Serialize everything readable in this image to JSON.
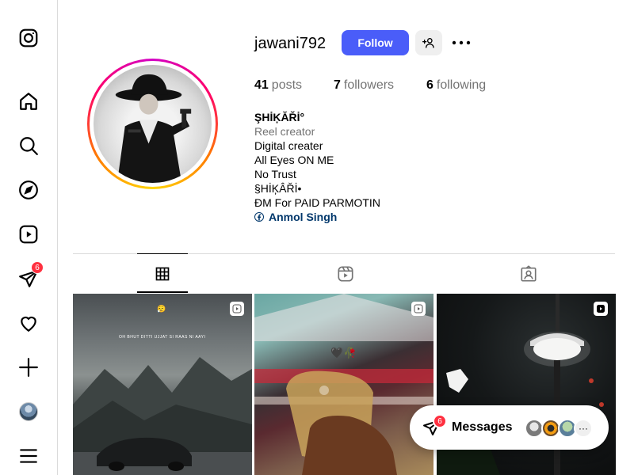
{
  "nav": {
    "items": [
      {
        "icon": "instagram-logo-icon"
      },
      {
        "icon": "home-icon"
      },
      {
        "icon": "search-icon"
      },
      {
        "icon": "explore-icon"
      },
      {
        "icon": "reels-icon"
      },
      {
        "icon": "messages-icon",
        "badge": "6"
      },
      {
        "icon": "notifications-icon"
      },
      {
        "icon": "create-icon"
      },
      {
        "icon": "profile-avatar"
      },
      {
        "icon": "menu-icon"
      }
    ]
  },
  "profile": {
    "username": "jawani792",
    "follow_label": "Follow",
    "stats": {
      "posts_count": "41",
      "posts_label": "posts",
      "followers_count": "7",
      "followers_label": "followers",
      "following_count": "6",
      "following_label": "following"
    },
    "bio": {
      "name": "ŞHİĶĂŘİ°",
      "category": "Reel creator",
      "lines": [
        "Digital creater",
        "All Eyes ON ME",
        "No Trust ",
        "§HİĶÂŘİ•",
        "ĐM For PAID PARMOTIN"
      ],
      "link_text": "Anmol Singh"
    }
  },
  "tabs": [
    {
      "name": "posts",
      "icon": "grid-icon",
      "active": true
    },
    {
      "name": "reels",
      "icon": "reels-icon",
      "active": false
    },
    {
      "name": "tagged",
      "icon": "tagged-icon",
      "active": false
    }
  ],
  "posts": [
    {
      "caption": "OH BHUT DITTI UJJAT SI RAAS NI AAYI",
      "emoji": "😮‍💨"
    },
    {
      "emoji": "🖤🥀"
    },
    {}
  ],
  "messages": {
    "label": "Messages",
    "badge": "6"
  },
  "colors": {
    "follow_button": "#4a5df9",
    "badge": "#ff3040",
    "link": "#00376b",
    "muted_text": "#737373"
  }
}
